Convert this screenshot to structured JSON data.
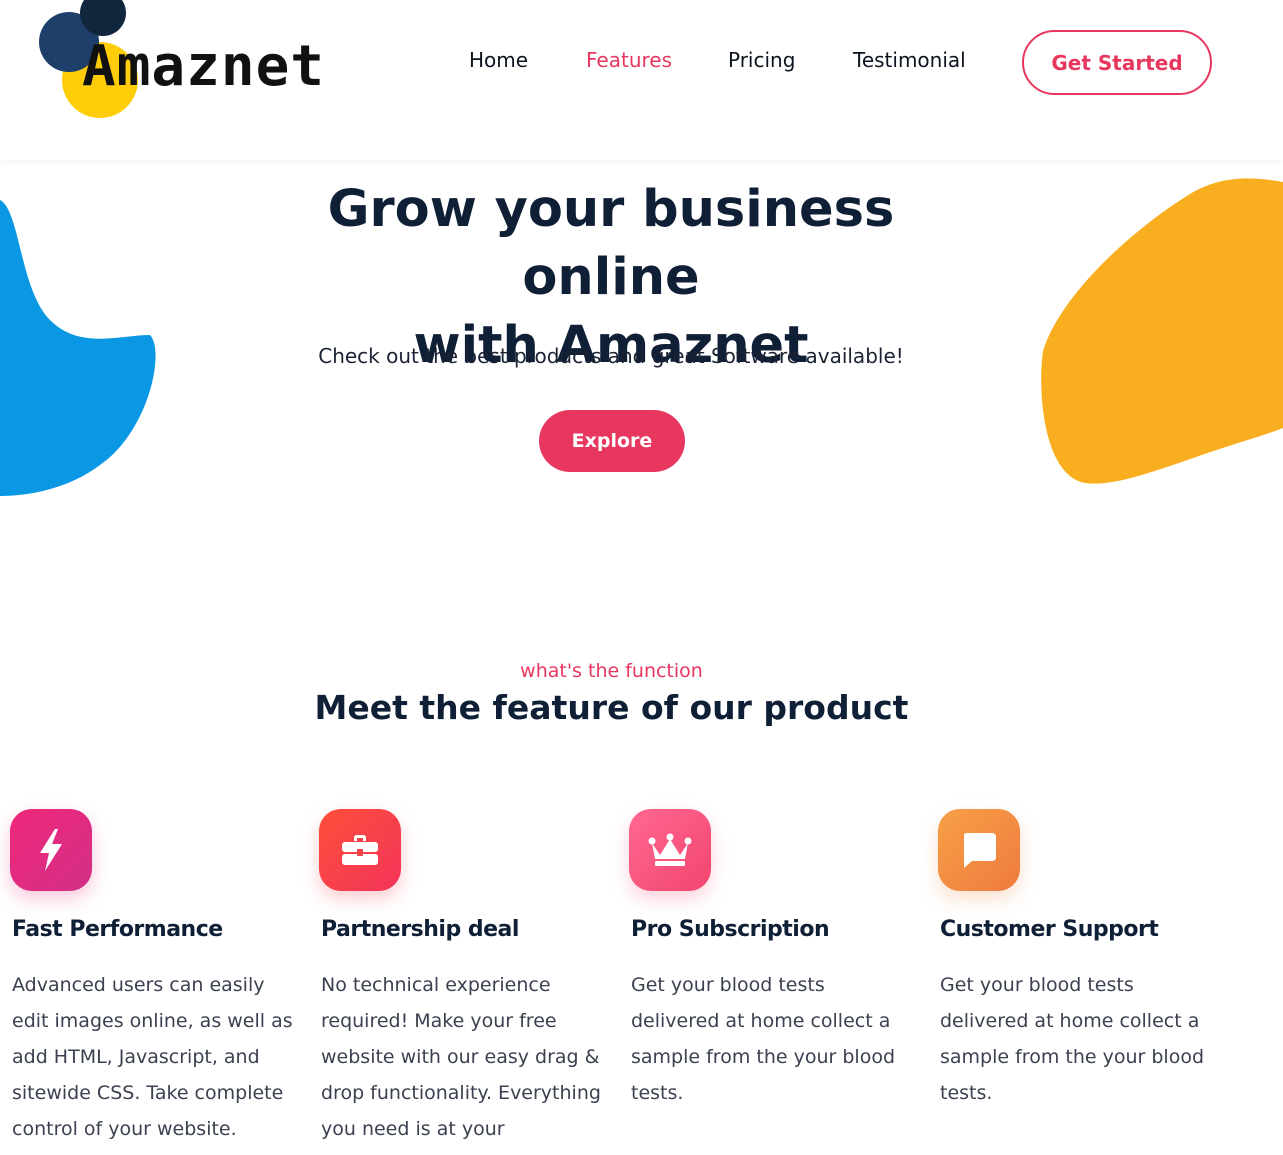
{
  "brand": {
    "name": "Amaznet"
  },
  "nav": {
    "items": [
      {
        "label": "Home"
      },
      {
        "label": "Features"
      },
      {
        "label": "Pricing"
      },
      {
        "label": "Testimonial"
      }
    ],
    "active": "Features",
    "cta_label": "Get Started"
  },
  "hero": {
    "title_line1": "Grow your business online",
    "title_line2": "with Amaznet",
    "subtitle": "Check out the best products and great Software available!",
    "button_label": "Explore"
  },
  "features_section": {
    "kicker": "what's the function",
    "title": "Meet the feature of our product",
    "items": [
      {
        "icon": "lightning-icon",
        "title": "Fast Performance",
        "description": "Advanced users can easily edit images online, as well as add HTML, Javascript, and sitewide CSS. Take complete control of your website."
      },
      {
        "icon": "briefcase-icon",
        "title": "Partnership deal",
        "description": "No technical experience required! Make your free website with our easy drag & drop functionality. Everything you need is at your fingertips."
      },
      {
        "icon": "crown-icon",
        "title": "Pro Subscription",
        "description": "Get your blood tests delivered at home collect a sample from the your blood tests."
      },
      {
        "icon": "chat-icon",
        "title": "Customer Support",
        "description": "Get your blood tests delivered at home collect a sample from the your blood tests."
      }
    ]
  },
  "colors": {
    "accent": "#e8375f",
    "heading": "#0f1f36",
    "blob_blue": "#0a98e4",
    "blob_yellow": "#f9ae1f",
    "logo_yellow": "#fecd08",
    "logo_navy": "#1f3f6b"
  }
}
